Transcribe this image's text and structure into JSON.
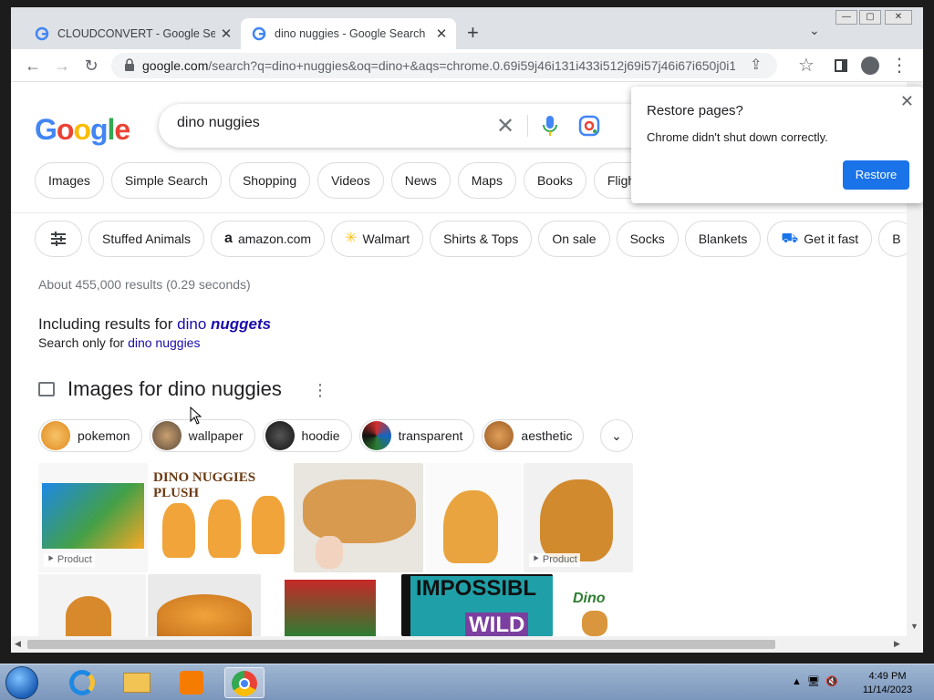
{
  "tabs": [
    {
      "title": "CLOUDCONVERT - Google Search",
      "close": "✕"
    },
    {
      "title": "dino nuggies - Google Search",
      "close": "✕"
    }
  ],
  "new_tab": "+",
  "url": {
    "host": "google.com",
    "rest": "/search?q=dino+nuggies&oq=dino+&aqs=chrome.0.69i59j46i131i433i512j69i57j46i67i650j0i10..."
  },
  "google": {
    "logo": "Google",
    "query": "dino nuggies",
    "nav_chips": [
      "Images",
      "Simple Search",
      "Shopping",
      "Videos",
      "News",
      "Maps",
      "Books",
      "Fligh"
    ],
    "filter_chips": [
      "Stuffed Animals",
      "amazon.com",
      "Walmart",
      "Shirts & Tops",
      "On sale",
      "Socks",
      "Blankets",
      "Get it fast",
      "B"
    ],
    "stats": "About 455,000 results (0.29 seconds)",
    "including_prefix": "Including results for ",
    "including_word1": "dino",
    "including_word2": "nuggets",
    "only_prefix": "Search only for ",
    "only_link": "dino nuggies",
    "images_header": "Images for dino nuggies",
    "related": [
      "pokemon",
      "wallpaper",
      "hoodie",
      "transparent",
      "aesthetic"
    ],
    "product_tag": "Product",
    "thumb_text": {
      "plush": "DINO NUGGIES PLUSH",
      "impossible": "IMPOSSIBL",
      "wild": "WILD",
      "dino": "Dino"
    }
  },
  "popup": {
    "title": "Restore pages?",
    "message": "Chrome didn't shut down correctly.",
    "button": "Restore",
    "close": "✕"
  },
  "taskbar": {
    "time": "4:49 PM",
    "date": "11/14/2023"
  }
}
